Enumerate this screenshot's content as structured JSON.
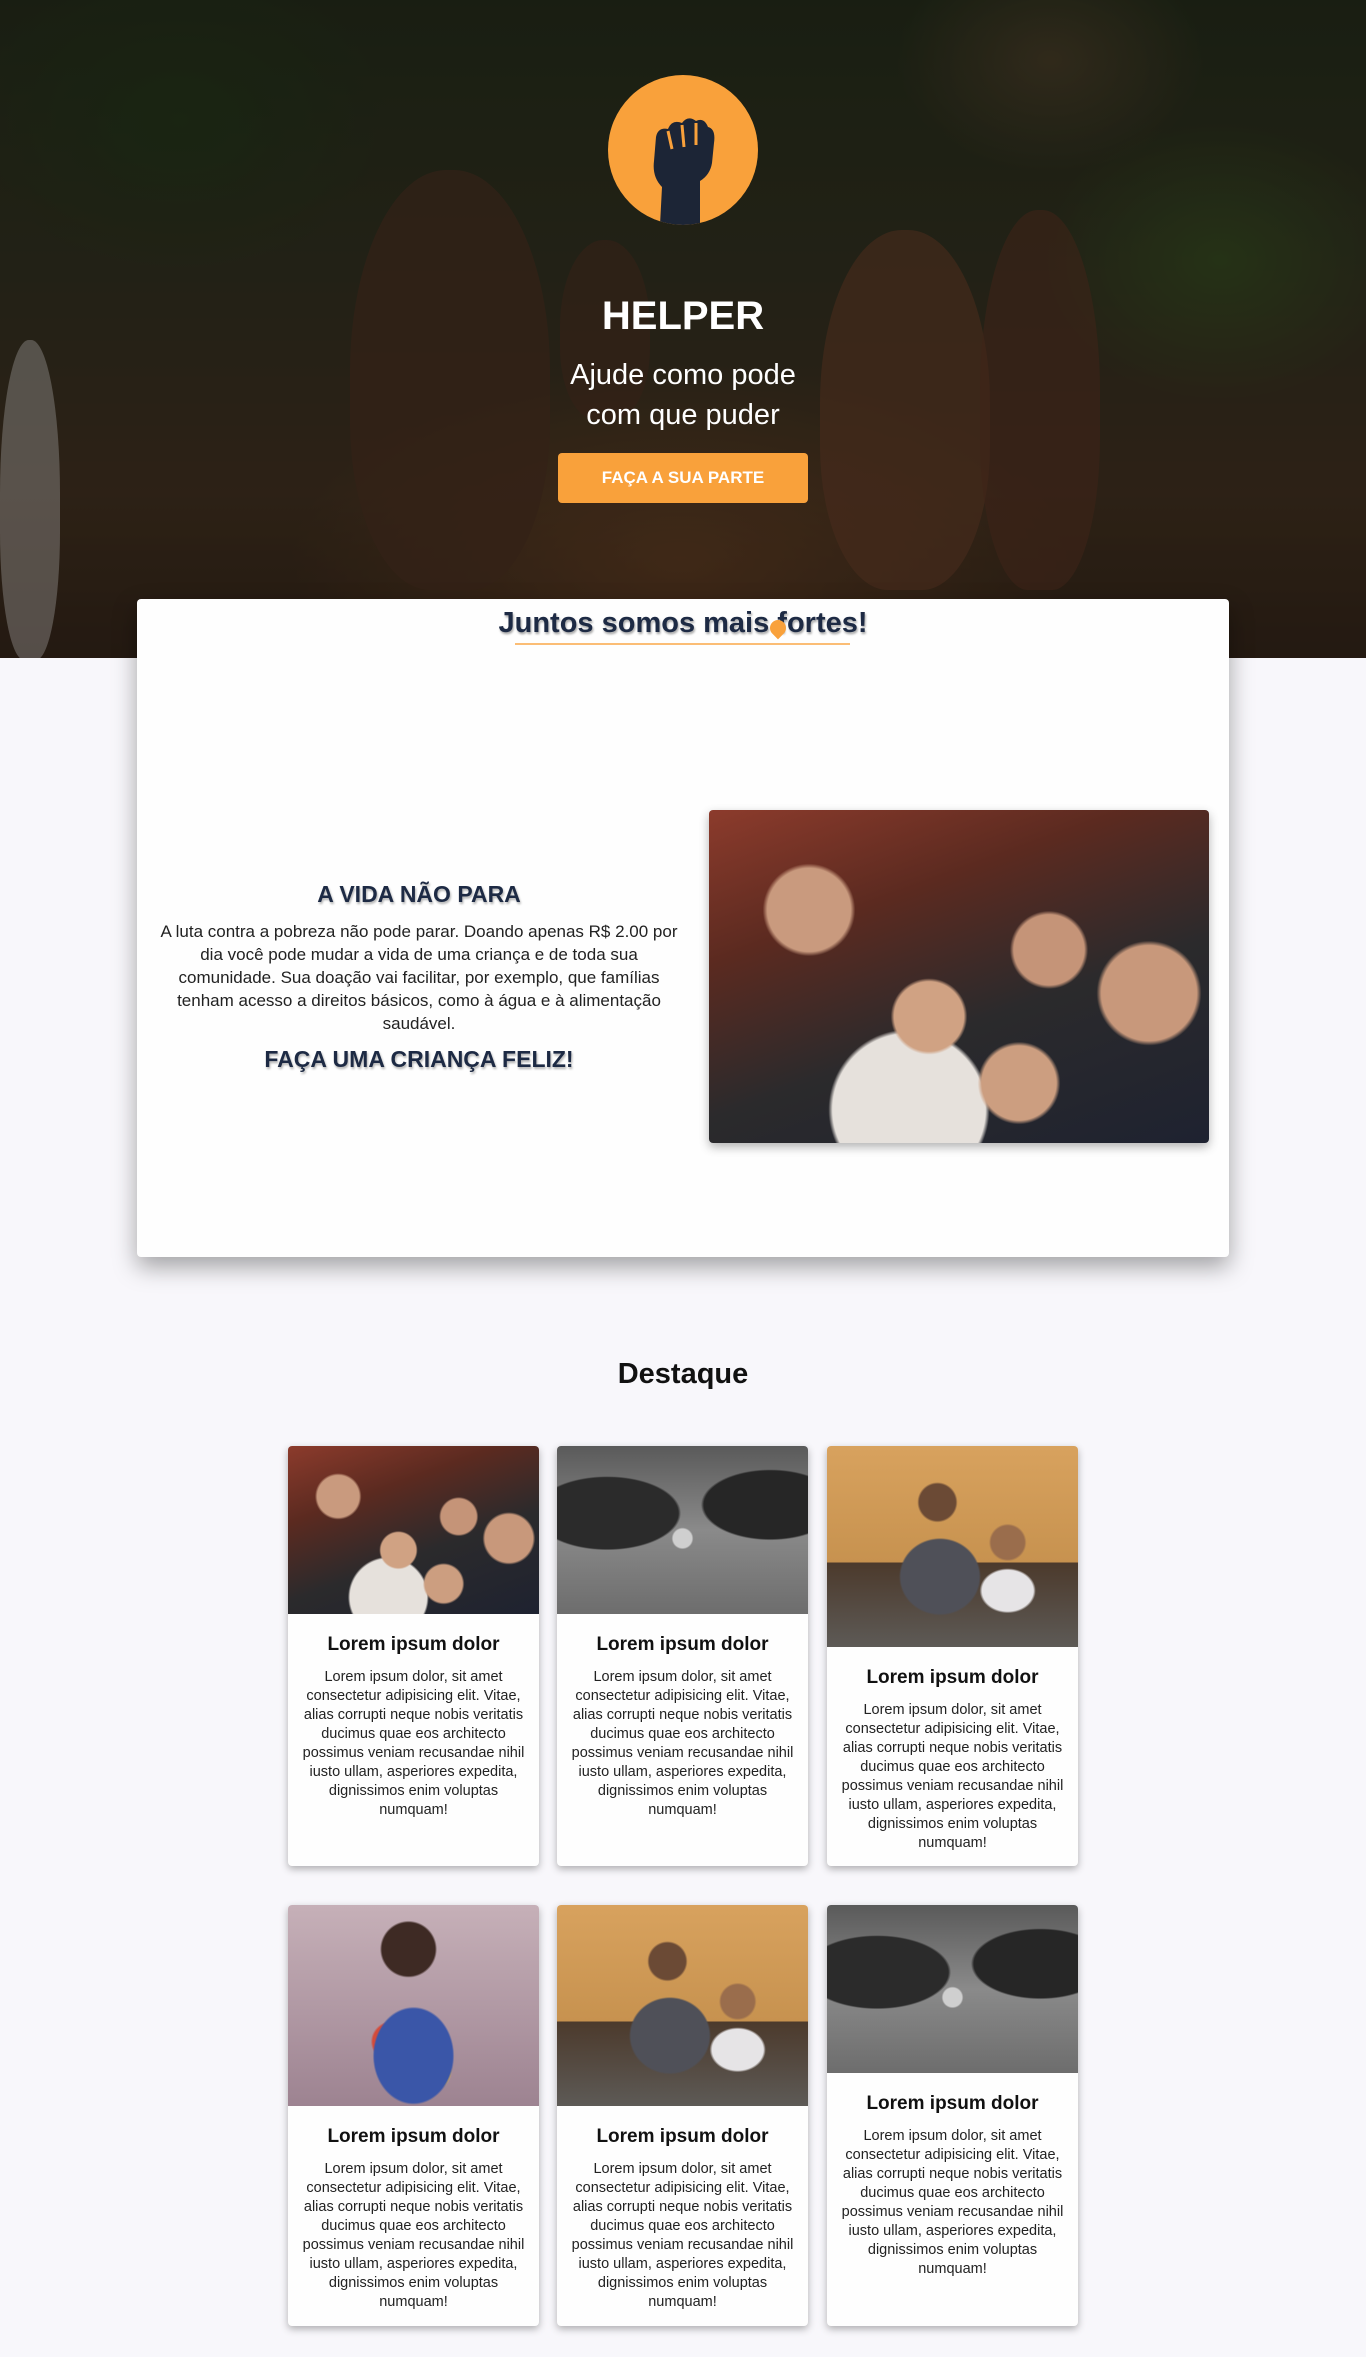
{
  "hero": {
    "brand": "HELPER",
    "tagline_line1": "Ajude como pode",
    "tagline_line2": "com que puder",
    "cta_label": "FAÇA A SUA PARTE",
    "accent_color": "#f9a13b",
    "logo_icon": "raised-fist-icon"
  },
  "main": {
    "together_title": "Juntos somos mais fortes!",
    "life_title": "A VIDA NÃO PARA",
    "life_text": "A luta contra a pobreza não pode parar. Doando apenas R$ 2.00 por dia você pode mudar a vida de uma criança e de toda sua comunidade. Sua doação vai facilitar, por exemplo, que famílias tenham acesso a direitos básicos, como à água e à alimentação saudável.",
    "life_cta": "FAÇA UMA CRIANÇA FELIZ!"
  },
  "featured": {
    "title": "Destaque",
    "cards": [
      {
        "title": "Lorem ipsum dolor",
        "text": "Lorem ipsum dolor, sit amet consectetur adipisicing elit. Vitae, alias corrupti neque nobis veritatis ducimus quae eos architecto possimus veniam recusandae nihil iusto ullam, asperiores expedita, dignissimos enim voluptas numquam!"
      },
      {
        "title": "Lorem ipsum dolor",
        "text": "Lorem ipsum dolor, sit amet consectetur adipisicing elit. Vitae, alias corrupti neque nobis veritatis ducimus quae eos architecto possimus veniam recusandae nihil iusto ullam, asperiores expedita, dignissimos enim voluptas numquam!"
      },
      {
        "title": "Lorem ipsum dolor",
        "text": "Lorem ipsum dolor, sit amet consectetur adipisicing elit. Vitae, alias corrupti neque nobis veritatis ducimus quae eos architecto possimus veniam recusandae nihil iusto ullam, asperiores expedita, dignissimos enim voluptas numquam!"
      },
      {
        "title": "Lorem ipsum dolor",
        "text": "Lorem ipsum dolor, sit amet consectetur adipisicing elit. Vitae, alias corrupti neque nobis veritatis ducimus quae eos architecto possimus veniam recusandae nihil iusto ullam, asperiores expedita, dignissimos enim voluptas numquam!"
      },
      {
        "title": "Lorem ipsum dolor",
        "text": "Lorem ipsum dolor, sit amet consectetur adipisicing elit. Vitae, alias corrupti neque nobis veritatis ducimus quae eos architecto possimus veniam recusandae nihil iusto ullam, asperiores expedita, dignissimos enim voluptas numquam!"
      },
      {
        "title": "Lorem ipsum dolor",
        "text": "Lorem ipsum dolor, sit amet consectetur adipisicing elit. Vitae, alias corrupti neque nobis veritatis ducimus quae eos architecto possimus veniam recusandae nihil iusto ullam, asperiores expedita, dignissimos enim voluptas numquam!"
      }
    ]
  }
}
